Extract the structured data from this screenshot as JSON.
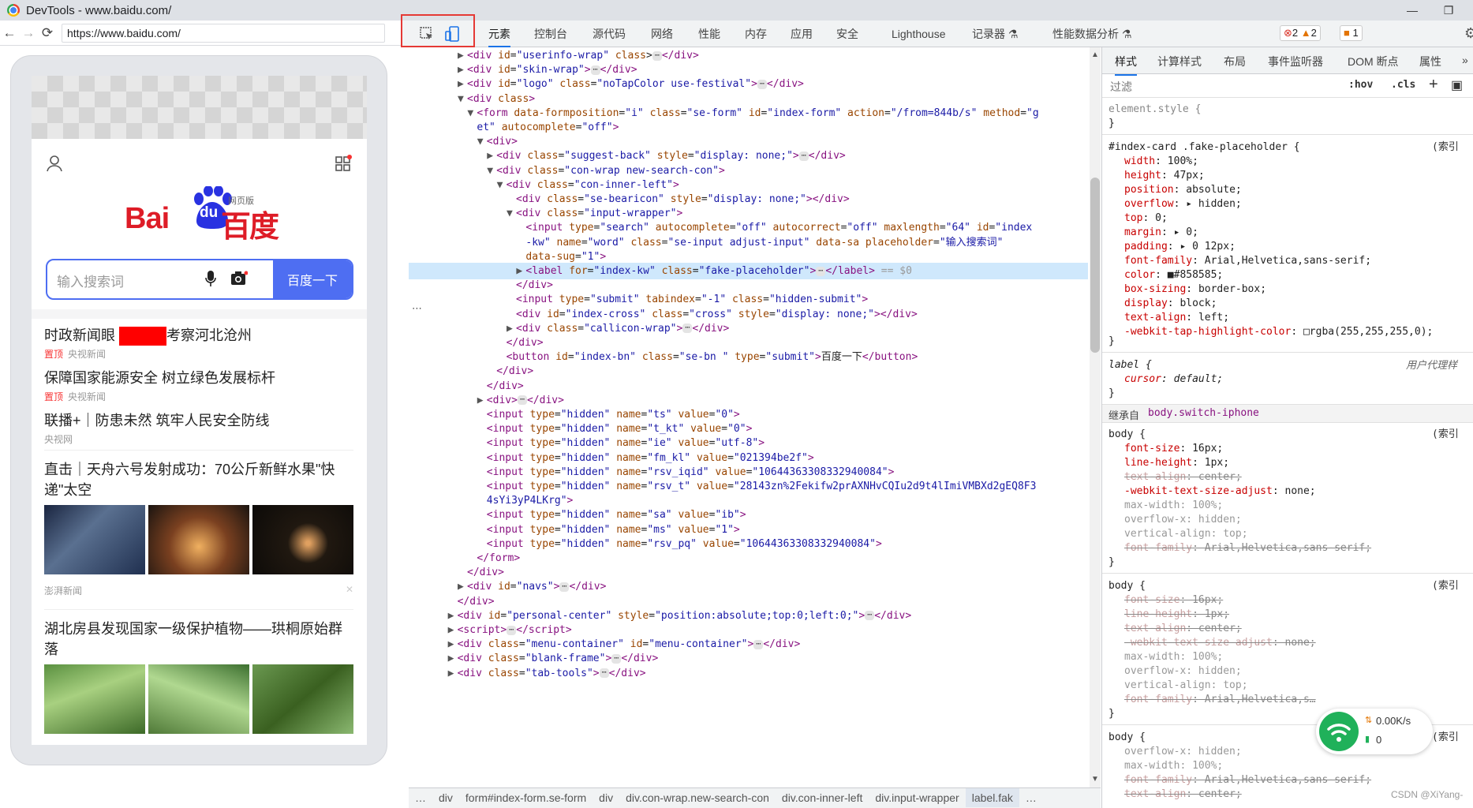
{
  "window": {
    "title": "DevTools - www.baidu.com/"
  },
  "browser": {
    "url": "https://www.baidu.com/"
  },
  "page": {
    "logo_bai": "Bai",
    "logo_du": "du",
    "logo_baidu": "百度",
    "logo_web": "网页版",
    "search_placeholder": "输入搜索词",
    "search_button": "百度一下",
    "news": [
      {
        "title": "时政新闻眼",
        "title2": "考察河北沧州",
        "tag": "置顶",
        "source": "央视新闻"
      },
      {
        "title": "保障国家能源安全 树立绿色发展标杆",
        "tag": "置顶",
        "source": "央视新闻"
      },
      {
        "title": "联播+｜防患未然 筑牢人民安全防线",
        "source": "央视网"
      },
      {
        "title": "直击｜天舟六号发射成功：70公斤新鲜水果\"快递\"太空",
        "source": "澎湃新闻"
      },
      {
        "title": "湖北房县发现国家一级保护植物——珙桐原始群落"
      }
    ]
  },
  "devtools": {
    "tabs": [
      "元素",
      "控制台",
      "源代码",
      "网络",
      "性能",
      "内存",
      "应用",
      "安全",
      "Lighthouse",
      "记录器 ⚗",
      "性能数据分析 ⚗"
    ],
    "errors": "2",
    "warnings": "2",
    "issues": "1",
    "elements": [
      {
        "i": 0,
        "tri": "▶",
        "html": "<span class='tag'>&lt;div</span> <span class='an'>id</span>=<span class='av'>\"userinfo-wrap\"</span> <span class='an'>class</span>&gt;<span class='ell'>⋯</span><span class='tag'>&lt;/div&gt;</span>"
      },
      {
        "i": 0,
        "tri": "▶",
        "html": "<span class='tag'>&lt;div</span> <span class='an'>id</span>=<span class='av'>\"skin-wrap\"</span><span class='tag'>&gt;</span><span class='ell'>⋯</span><span class='tag'>&lt;/div&gt;</span>"
      },
      {
        "i": 0,
        "tri": "▶",
        "html": "<span class='tag'>&lt;div</span> <span class='an'>id</span>=<span class='av'>\"logo\"</span> <span class='an'>class</span>=<span class='av'>\"noTapColor use-festival\"</span><span class='tag'>&gt;</span><span class='ell'>⋯</span><span class='tag'>&lt;/div&gt;</span>"
      },
      {
        "i": 0,
        "tri": "▼",
        "html": "<span class='tag'>&lt;div</span> <span class='an'>class</span><span class='tag'>&gt;</span>"
      },
      {
        "i": 1,
        "tri": "▼",
        "html": "<span class='tag'>&lt;form</span> <span class='an'>data-formposition</span>=<span class='av'>\"i\"</span> <span class='an'>class</span>=<span class='av'>\"se-form\"</span> <span class='an'>id</span>=<span class='av'>\"index-form\"</span> <span class='an'>action</span>=<span class='av'>\"/from=844b/s\"</span> <span class='an'>method</span>=<span class='av'>\"g</span>"
      },
      {
        "i": 1,
        "tri": "",
        "html": "<span class='av'>et\"</span> <span class='an'>autocomplete</span>=<span class='av'>\"off\"</span><span class='tag'>&gt;</span>"
      },
      {
        "i": 2,
        "tri": "▼",
        "html": "<span class='tag'>&lt;div&gt;</span>"
      },
      {
        "i": 3,
        "tri": "▶",
        "html": "<span class='tag'>&lt;div</span> <span class='an'>class</span>=<span class='av'>\"suggest-back\"</span> <span class='an'>style</span>=<span class='av'>\"display: none;\"</span><span class='tag'>&gt;</span><span class='ell'>⋯</span><span class='tag'>&lt;/div&gt;</span>"
      },
      {
        "i": 3,
        "tri": "▼",
        "html": "<span class='tag'>&lt;div</span> <span class='an'>class</span>=<span class='av'>\"con-wrap new-search-con\"</span><span class='tag'>&gt;</span>"
      },
      {
        "i": 4,
        "tri": "▼",
        "html": "<span class='tag'>&lt;div</span> <span class='an'>class</span>=<span class='av'>\"con-inner-left\"</span><span class='tag'>&gt;</span>"
      },
      {
        "i": 5,
        "tri": "",
        "html": "<span class='tag'>&lt;div</span> <span class='an'>class</span>=<span class='av'>\"se-bearicon\"</span> <span class='an'>style</span>=<span class='av'>\"display: none;\"</span><span class='tag'>&gt;&lt;/div&gt;</span>"
      },
      {
        "i": 5,
        "tri": "▼",
        "html": "<span class='tag'>&lt;div</span> <span class='an'>class</span>=<span class='av'>\"input-wrapper\"</span><span class='tag'>&gt;</span>"
      },
      {
        "i": 6,
        "tri": "",
        "html": "<span class='tag'>&lt;input</span> <span class='an'>type</span>=<span class='av'>\"search\"</span> <span class='an'>autocomplete</span>=<span class='av'>\"off\"</span> <span class='an'>autocorrect</span>=<span class='av'>\"off\"</span> <span class='an'>maxlength</span>=<span class='av'>\"64\"</span> <span class='an'>id</span>=<span class='av'>\"index</span>"
      },
      {
        "i": 6,
        "tri": "",
        "html": "<span class='av'>-kw\"</span> <span class='an'>name</span>=<span class='av'>\"word\"</span> <span class='an'>class</span>=<span class='av'>\"se-input adjust-input\"</span> <span class='an'>data-sa</span> <span class='an'>placeholder</span>=<span class='av'>\"输入搜索词\"</span>"
      },
      {
        "i": 6,
        "tri": "",
        "html": "<span class='an'>data-sug</span>=<span class='av'>\"1\"</span><span class='tag'>&gt;</span>"
      },
      {
        "i": 6,
        "tri": "▶",
        "sel": true,
        "html": "<span class='tag'>&lt;label</span> <span class='an'>for</span>=<span class='av'>\"index-kw\"</span> <span class='an'>class</span>=<span class='av'>\"fake-placeholder\"</span><span class='tag'>&gt;</span><span class='ell'>⋯</span><span class='tag'>&lt;/label&gt;</span> <span class='dim'>== $0</span>"
      },
      {
        "i": 5,
        "tri": "",
        "html": "<span class='tag'>&lt;/div&gt;</span>"
      },
      {
        "i": 5,
        "tri": "",
        "html": "<span class='tag'>&lt;input</span> <span class='an'>type</span>=<span class='av'>\"submit\"</span> <span class='an'>tabindex</span>=<span class='av'>\"-1\"</span> <span class='an'>class</span>=<span class='av'>\"hidden-submit\"</span><span class='tag'>&gt;</span>"
      },
      {
        "i": 5,
        "tri": "",
        "html": "<span class='tag'>&lt;div</span> <span class='an'>id</span>=<span class='av'>\"index-cross\"</span> <span class='an'>class</span>=<span class='av'>\"cross\"</span> <span class='an'>style</span>=<span class='av'>\"display: none;\"</span><span class='tag'>&gt;&lt;/div&gt;</span>"
      },
      {
        "i": 5,
        "tri": "▶",
        "html": "<span class='tag'>&lt;div</span> <span class='an'>class</span>=<span class='av'>\"callicon-wrap\"</span><span class='tag'>&gt;</span><span class='ell'>⋯</span><span class='tag'>&lt;/div&gt;</span>"
      },
      {
        "i": 4,
        "tri": "",
        "html": "<span class='tag'>&lt;/div&gt;</span>"
      },
      {
        "i": 4,
        "tri": "",
        "html": "<span class='tag'>&lt;button</span> <span class='an'>id</span>=<span class='av'>\"index-bn\"</span> <span class='an'>class</span>=<span class='av'>\"se-bn \"</span> <span class='an'>type</span>=<span class='av'>\"submit\"</span><span class='tag'>&gt;</span>百度一下<span class='tag'>&lt;/button&gt;</span>"
      },
      {
        "i": 3,
        "tri": "",
        "html": "<span class='tag'>&lt;/div&gt;</span>"
      },
      {
        "i": 2,
        "tri": "",
        "html": "<span class='tag'>&lt;/div&gt;</span>"
      },
      {
        "i": 2,
        "tri": "▶",
        "html": "<span class='tag'>&lt;div&gt;</span><span class='ell'>⋯</span><span class='tag'>&lt;/div&gt;</span>"
      },
      {
        "i": 2,
        "tri": "",
        "html": "<span class='tag'>&lt;input</span> <span class='an'>type</span>=<span class='av'>\"hidden\"</span> <span class='an'>name</span>=<span class='av'>\"ts\"</span> <span class='an'>value</span>=<span class='av'>\"0\"</span><span class='tag'>&gt;</span>"
      },
      {
        "i": 2,
        "tri": "",
        "html": "<span class='tag'>&lt;input</span> <span class='an'>type</span>=<span class='av'>\"hidden\"</span> <span class='an'>name</span>=<span class='av'>\"t_kt\"</span> <span class='an'>value</span>=<span class='av'>\"0\"</span><span class='tag'>&gt;</span>"
      },
      {
        "i": 2,
        "tri": "",
        "html": "<span class='tag'>&lt;input</span> <span class='an'>type</span>=<span class='av'>\"hidden\"</span> <span class='an'>name</span>=<span class='av'>\"ie\"</span> <span class='an'>value</span>=<span class='av'>\"utf-8\"</span><span class='tag'>&gt;</span>"
      },
      {
        "i": 2,
        "tri": "",
        "html": "<span class='tag'>&lt;input</span> <span class='an'>type</span>=<span class='av'>\"hidden\"</span> <span class='an'>name</span>=<span class='av'>\"fm_kl\"</span> <span class='an'>value</span>=<span class='av'>\"021394be2f\"</span><span class='tag'>&gt;</span>"
      },
      {
        "i": 2,
        "tri": "",
        "html": "<span class='tag'>&lt;input</span> <span class='an'>type</span>=<span class='av'>\"hidden\"</span> <span class='an'>name</span>=<span class='av'>\"rsv_iqid\"</span> <span class='an'>value</span>=<span class='av'>\"10644363308332940084\"</span><span class='tag'>&gt;</span>"
      },
      {
        "i": 2,
        "tri": "",
        "html": "<span class='tag'>&lt;input</span> <span class='an'>type</span>=<span class='av'>\"hidden\"</span> <span class='an'>name</span>=<span class='av'>\"rsv_t\"</span> <span class='an'>value</span>=<span class='av'>\"28143zn%2Fekifw2prAXNHvCQIu2d9t4lImiVMBXd2gEQ8F3</span>"
      },
      {
        "i": 2,
        "tri": "",
        "html": "<span class='av'>4sYi3yP4LKrg\"</span><span class='tag'>&gt;</span>"
      },
      {
        "i": 2,
        "tri": "",
        "html": "<span class='tag'>&lt;input</span> <span class='an'>type</span>=<span class='av'>\"hidden\"</span> <span class='an'>name</span>=<span class='av'>\"sa\"</span> <span class='an'>value</span>=<span class='av'>\"ib\"</span><span class='tag'>&gt;</span>"
      },
      {
        "i": 2,
        "tri": "",
        "html": "<span class='tag'>&lt;input</span> <span class='an'>type</span>=<span class='av'>\"hidden\"</span> <span class='an'>name</span>=<span class='av'>\"ms\"</span> <span class='an'>value</span>=<span class='av'>\"1\"</span><span class='tag'>&gt;</span>"
      },
      {
        "i": 2,
        "tri": "",
        "html": "<span class='tag'>&lt;input</span> <span class='an'>type</span>=<span class='av'>\"hidden\"</span> <span class='an'>name</span>=<span class='av'>\"rsv_pq\"</span> <span class='an'>value</span>=<span class='av'>\"10644363308332940084\"</span><span class='tag'>&gt;</span>"
      },
      {
        "i": 1,
        "tri": "",
        "html": "<span class='tag'>&lt;/form&gt;</span>"
      },
      {
        "i": 0,
        "tri": "",
        "html": "<span class='tag'>&lt;/div&gt;</span>"
      },
      {
        "i": 0,
        "tri": "▶",
        "html": "<span class='tag'>&lt;div</span> <span class='an'>id</span>=<span class='av'>\"navs\"</span><span class='tag'>&gt;</span><span class='ell'>⋯</span><span class='tag'>&lt;/div&gt;</span>"
      },
      {
        "i": -1,
        "tri": "",
        "html": "<span class='tag'>&lt;/div&gt;</span>"
      },
      {
        "i": -1,
        "tri": "▶",
        "html": "<span class='tag'>&lt;div</span> <span class='an'>id</span>=<span class='av'>\"personal-center\"</span> <span class='an'>style</span>=<span class='av'>\"position:absolute;top:0;left:0;\"</span><span class='tag'>&gt;</span><span class='ell'>⋯</span><span class='tag'>&lt;/div&gt;</span>"
      },
      {
        "i": -1,
        "tri": "▶",
        "html": "<span class='tag'>&lt;script&gt;</span><span class='ell'>⋯</span><span class='tag'>&lt;/script&gt;</span>"
      },
      {
        "i": -1,
        "tri": "▶",
        "html": "<span class='tag'>&lt;div</span> <span class='an'>class</span>=<span class='av'>\"menu-container\"</span> <span class='an'>id</span>=<span class='av'>\"menu-container\"</span><span class='tag'>&gt;</span><span class='ell'>⋯</span><span class='tag'>&lt;/div&gt;</span>"
      },
      {
        "i": -1,
        "tri": "▶",
        "html": "<span class='tag'>&lt;div</span> <span class='an'>class</span>=<span class='av'>\"blank-frame\"</span><span class='tag'>&gt;</span><span class='ell'>⋯</span><span class='tag'>&lt;/div&gt;</span>"
      },
      {
        "i": -1,
        "tri": "▶",
        "html": "<span class='tag'>&lt;div</span> <span class='an'>class</span>=<span class='av'>\"tab-tools\"</span><span class='tag'>&gt;</span><span class='ell'>⋯</span><span class='tag'>&lt;/div&gt;</span>"
      }
    ],
    "breadcrumb": [
      "…",
      "div",
      "form#index-form.se-form",
      "div",
      "div.con-wrap.new-search-con",
      "div.con-inner-left",
      "div.input-wrapper",
      "label.fak",
      "…"
    ],
    "styles_tabs": [
      "样式",
      "计算样式",
      "布局",
      "事件监听器",
      "DOM 断点",
      "属性"
    ],
    "filter_placeholder": "过滤",
    "hov": ":hov",
    "cls": ".cls",
    "index_link": "(索引",
    "ua_sheet": "用户代理样",
    "inherit_label": "继承自",
    "inherit_selector": "body.switch-iphone",
    "rules_fake": [
      [
        "width",
        "100%;"
      ],
      [
        "height",
        "47px;"
      ],
      [
        "position",
        "absolute;"
      ],
      [
        "overflow",
        "▸ hidden;"
      ],
      [
        "top",
        "0;"
      ],
      [
        "margin",
        "▸ 0;"
      ],
      [
        "padding",
        "▸ 0 12px;"
      ],
      [
        "font-family",
        "Arial,Helvetica,sans-serif;"
      ],
      [
        "color",
        "■#858585;"
      ],
      [
        "box-sizing",
        "border-box;"
      ],
      [
        "display",
        "block;"
      ],
      [
        "text-align",
        "left;"
      ],
      [
        "-webkit-tap-highlight-color",
        "□rgba(255,255,255,0);"
      ]
    ],
    "wifi_speed": "0.00K/s",
    "wifi_count": "0",
    "watermark": "CSDN @XiYang-"
  }
}
